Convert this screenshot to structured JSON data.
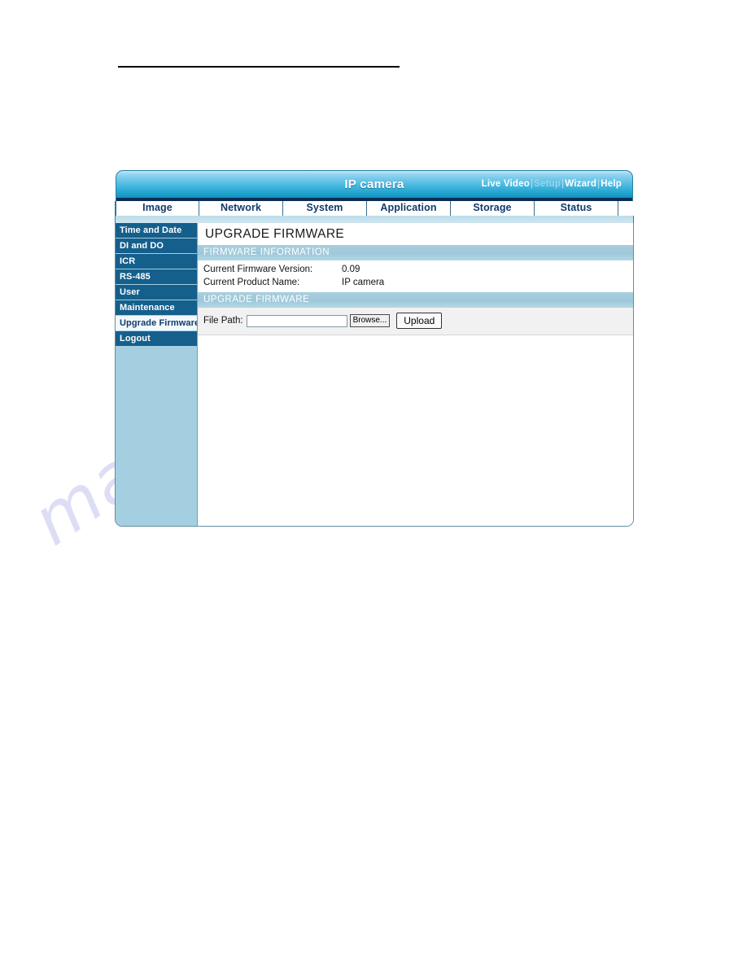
{
  "document": {
    "rule": "horizontal-rule"
  },
  "watermark": {
    "text": "manualshive.com"
  },
  "panel": {
    "header": {
      "title": "IP camera",
      "links": [
        {
          "label": "Live Video",
          "state": "active"
        },
        {
          "label": "Setup",
          "state": "current"
        },
        {
          "label": "Wizard",
          "state": "active"
        },
        {
          "label": "Help",
          "state": "active"
        }
      ],
      "separator": "|"
    },
    "tabs": [
      {
        "label": "Image"
      },
      {
        "label": "Network"
      },
      {
        "label": "System"
      },
      {
        "label": "Application"
      },
      {
        "label": "Storage"
      },
      {
        "label": "Status"
      }
    ],
    "sidebar": {
      "items": [
        {
          "label": "Time and Date",
          "selected": false
        },
        {
          "label": "DI and DO",
          "selected": false
        },
        {
          "label": "ICR",
          "selected": false
        },
        {
          "label": "RS-485",
          "selected": false
        },
        {
          "label": "User",
          "selected": false
        },
        {
          "label": "Maintenance",
          "selected": false
        },
        {
          "label": "Upgrade Firmware",
          "selected": true
        },
        {
          "label": "Logout",
          "selected": false
        }
      ]
    },
    "content": {
      "page_title": "UPGRADE FIRMWARE",
      "sections": [
        {
          "heading": "FIRMWARE INFORMATION",
          "rows": [
            {
              "label": "Current Firmware Version:",
              "value": "0.09"
            },
            {
              "label": "Current Product Name:",
              "value": "IP camera"
            }
          ]
        },
        {
          "heading": "UPGRADE FIRMWARE",
          "file_path_label": "File Path:",
          "file_path_value": "",
          "file_path_placeholder": "",
          "browse_label": "Browse...",
          "upload_label": "Upload"
        }
      ]
    }
  },
  "colors": {
    "header_top": "#bfe4f5",
    "header_bottom": "#0b7ea8",
    "header_edge": "#0b2d55",
    "sidebar_bg": "#a4cfe0",
    "sidebar_item_bg": "#155f8c",
    "sidebar_item_selected_bg": "#f2f8fb",
    "tab_text": "#123a6b",
    "section_bar": "#9ec8da",
    "form_bg": "#f1f1f1",
    "watermark": "#c9c9ef"
  }
}
